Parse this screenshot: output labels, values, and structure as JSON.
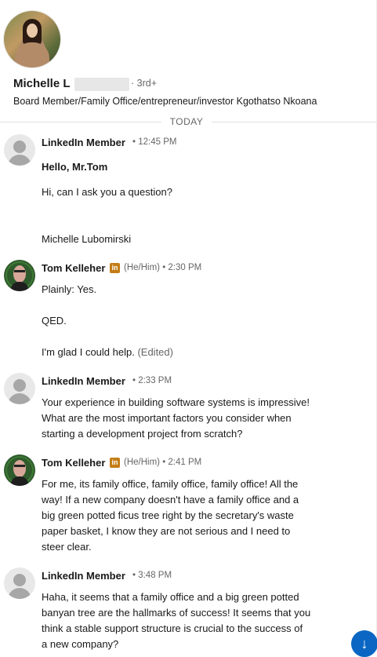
{
  "profile": {
    "name": "Michelle L",
    "degree": "· 3rd+",
    "headline": "Board Member/Family Office/entrepreneur/investor Kgothatso Nkoana"
  },
  "divider": {
    "label": "TODAY"
  },
  "messages": [
    {
      "sender": "LinkedIn Member",
      "time": "• 12:45 PM",
      "lines": [
        "Hello, Mr.Tom",
        "Hi, can I ask you a question?",
        "Michelle Lubomirski"
      ]
    },
    {
      "sender": "Tom Kelleher",
      "badge": "in",
      "pronoun": "(He/Him) • 2:30 PM",
      "lines": [
        "Plainly:  Yes.",
        "QED.",
        "I'm glad I could help."
      ],
      "edited": "(Edited)"
    },
    {
      "sender": "LinkedIn Member",
      "time": "• 2:33 PM",
      "lines": [
        "Your experience in building software systems is impressive!",
        "What are the most important factors you consider when",
        "starting a development project from scratch?"
      ]
    },
    {
      "sender": "Tom Kelleher",
      "badge": "in",
      "pronoun": "(He/Him) • 2:41 PM",
      "lines": [
        "For me, its family office, family office, family office!  All the",
        "way!  If a new company doesn't have a family office and a",
        "big green potted ficus tree right by the secretary's waste",
        "paper basket, I know they are not serious and I need to",
        "steer clear."
      ]
    },
    {
      "sender": "LinkedIn Member",
      "time": "• 3:48 PM",
      "lines": [
        "Haha, it seems that a family office and a big green potted",
        "banyan tree are the hallmarks of success! It seems that you",
        "think a stable support structure is crucial to the success of",
        "a new company?"
      ]
    }
  ],
  "scroll_button": {
    "icon": "arrow-down-icon",
    "glyph": "↓"
  },
  "colors": {
    "accent": "#0a66c2",
    "badge": "#c37d16",
    "meta": "#666666"
  }
}
